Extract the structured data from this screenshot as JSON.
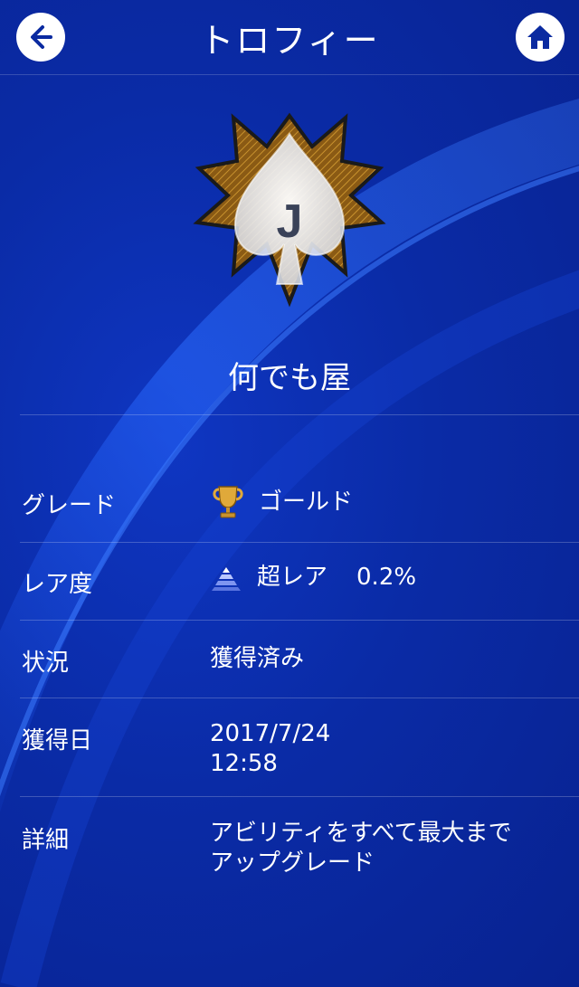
{
  "header": {
    "title": "トロフィー",
    "back_icon": "arrow-left-icon",
    "home_icon": "home-icon"
  },
  "trophy": {
    "icon": "spade-j-trophy-icon",
    "card_letter": "J",
    "name": "何でも屋"
  },
  "details": {
    "grade": {
      "label": "グレード",
      "icon": "gold-trophy-icon",
      "value": "ゴールド"
    },
    "rarity": {
      "label": "レア度",
      "icon": "ultra-rare-pyramid-icon",
      "value": "超レア",
      "percent": "0.2%"
    },
    "status": {
      "label": "状況",
      "value": "獲得済み"
    },
    "earned": {
      "label": "獲得日",
      "date": "2017/7/24",
      "time": "12:58"
    },
    "description": {
      "label": "詳細",
      "line1": "アビリティをすべて最大まで",
      "line2": "アップグレード"
    }
  },
  "colors": {
    "background": "#0a2aa0",
    "accent_gold": "#c8922e",
    "text": "#ffffff"
  }
}
